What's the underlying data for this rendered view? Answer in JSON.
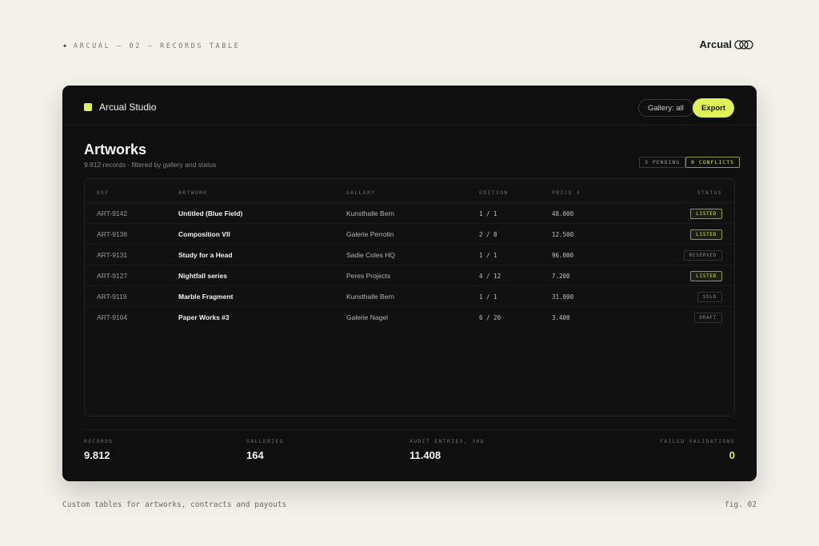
{
  "caption": {
    "star": "✦",
    "text": "ARCUAL — 02 — RECORDS TABLE"
  },
  "brand": {
    "name": "Arcual"
  },
  "header": {
    "studio": "Arcual Studio",
    "filter": "Gallery: all",
    "export": "Export"
  },
  "page": {
    "title": "Artworks",
    "subtitle": "9.812 records · filtered by gallery and status",
    "badges": {
      "pending": "3 PENDING",
      "conflicts": "0 CONFLICTS"
    }
  },
  "table": {
    "columns": [
      "REF",
      "ARTWORK",
      "GALLERY",
      "EDITION",
      "PRICE €",
      "STATUS"
    ],
    "rows": [
      {
        "ref": "ART-9142",
        "artwork": "Untitled (Blue Field)",
        "gallery": "Kunsthalle Bern",
        "edition": "1 / 1",
        "price": "48.000",
        "status": "LISTED",
        "kind": "listed"
      },
      {
        "ref": "ART-9138",
        "artwork": "Composition VII",
        "gallery": "Galerie Perrotin",
        "edition": "2 / 8",
        "price": "12.500",
        "status": "LISTED",
        "kind": "listed"
      },
      {
        "ref": "ART-9131",
        "artwork": "Study for a Head",
        "gallery": "Sadie Coles HQ",
        "edition": "1 / 1",
        "price": "96.000",
        "status": "RESERVED",
        "kind": "reserved"
      },
      {
        "ref": "ART-9127",
        "artwork": "Nightfall series",
        "gallery": "Peres Projects",
        "edition": "4 / 12",
        "price": "7.200",
        "status": "LISTED",
        "kind": "listed"
      },
      {
        "ref": "ART-9119",
        "artwork": "Marble Fragment",
        "gallery": "Kunsthalle Bern",
        "edition": "1 / 1",
        "price": "31.000",
        "status": "SOLD",
        "kind": "sold"
      },
      {
        "ref": "ART-9104",
        "artwork": "Paper Works #3",
        "gallery": "Galerie Nagel",
        "edition": "6 / 20",
        "price": "3.400",
        "status": "DRAFT",
        "kind": "draft"
      }
    ]
  },
  "stats": [
    {
      "label": "RECORDS",
      "value": "9.812"
    },
    {
      "label": "GALLERIES",
      "value": "164"
    },
    {
      "label": "AUDIT ENTRIES, 30D",
      "value": "11.408"
    },
    {
      "label": "FAILED VALIDATIONS",
      "value": "0"
    }
  ],
  "footer": {
    "caption": "Custom tables for artworks, contracts and payouts",
    "fig": "fig. 02"
  },
  "colors": {
    "accent": "#e0f15a",
    "card": "#0f0f0f",
    "page": "#f4f1ea"
  }
}
